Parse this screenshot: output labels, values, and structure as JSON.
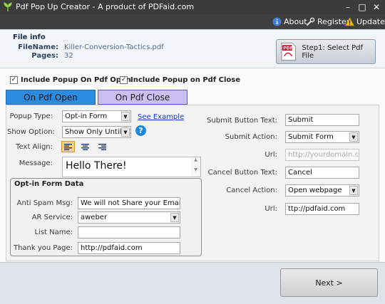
{
  "window": {
    "title": "Pdf Pop Up Creator - A product of PDFaid.com",
    "minimize_glyph": "–",
    "maximize_glyph": "□",
    "close_glyph": "✕"
  },
  "menu": {
    "about": "About",
    "register": "Register",
    "update": "Update"
  },
  "file_info": {
    "header": "File info",
    "filename_label": "FileName:",
    "filename_value": "Killer-Conversion-Tactics.pdf",
    "pages_label": "Pages:",
    "pages_value": "32",
    "select_button": "Step1: Select Pdf File"
  },
  "options": {
    "include_on_open": "Include Popup On Pdf Open",
    "include_on_open_checked": true,
    "include_on_close": "Include Popup on Pdf Close",
    "include_on_close_checked": true,
    "check_glyph": "✓"
  },
  "tabs": {
    "open": "On Pdf Open",
    "close": "On Pdf Close",
    "active": "open"
  },
  "left_form": {
    "popup_type_label": "Popup Type:",
    "popup_type_value": "Opt-in Form",
    "see_example": "See Example",
    "show_option_label": "Show Option:",
    "show_option_value": "Show Only Untill C",
    "help_glyph": "?",
    "text_align_label": "Text Align:",
    "text_align_active": "left",
    "message_label": "Message:",
    "message_value": "Hello There!"
  },
  "optin": {
    "header": "Opt-in Form Data",
    "anti_spam_label": "Anti Spam Msg:",
    "anti_spam_value": "We will not Share your Email",
    "ar_service_label": "AR Service:",
    "ar_service_value": "aweber",
    "list_name_label": "List Name:",
    "list_name_value": "",
    "thank_you_label": "Thank you Page:",
    "thank_you_value": "http://pdfaid.com"
  },
  "right_form": {
    "submit_text_label": "Submit Button Text:",
    "submit_text_value": "Submit",
    "submit_action_label": "Submit Action:",
    "submit_action_value": "Submit Form",
    "url1_label": "Url:",
    "url1_placeholder": "http://yourdomain.com",
    "cancel_text_label": "Cancel Button Text:",
    "cancel_text_value": "Cancel",
    "cancel_action_label": "Cancel Action:",
    "cancel_action_value": "Open webpage",
    "url2_label": "Url:",
    "url2_value": "ttp://pdfaid.com"
  },
  "footer": {
    "next": "Next >"
  },
  "colors": {
    "tab_active": "#2a8be0",
    "tab_inactive": "#c9c0f0",
    "titlebar": "#3b3b3b",
    "warning": "#f2b705",
    "help": "#1e88d8"
  }
}
